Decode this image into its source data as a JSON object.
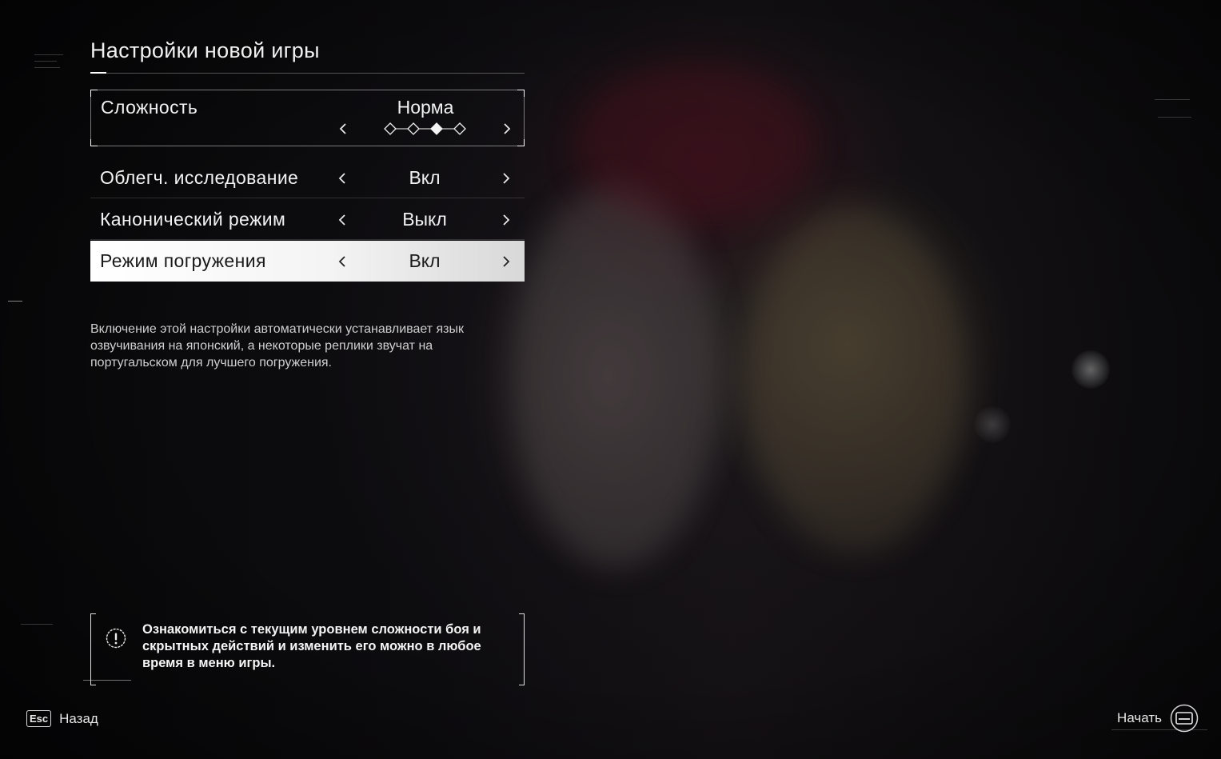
{
  "screen": {
    "title": "Настройки новой игры"
  },
  "settings": {
    "difficulty": {
      "label": "Сложность",
      "value": "Норма",
      "levels_total": 4,
      "level_selected": 3
    },
    "rows": [
      {
        "label": "Облегч. исследование",
        "value": "Вкл"
      },
      {
        "label": "Канонический режим",
        "value": "Выкл"
      },
      {
        "label": "Режим погружения",
        "value": "Вкл",
        "selected": true
      }
    ]
  },
  "description": {
    "line1": "Включение этой настройки автоматически устанавливает язык",
    "line2": "озвучивания на японский, а некоторые реплики звучат на",
    "line3": "португальском для лучшего погружения."
  },
  "notice": {
    "icon": "exclamation-icon",
    "line1": "Ознакомиться с текущим уровнем сложности боя и",
    "line2": "скрытных действий и изменить его можно в любое",
    "line3": "время в меню игры."
  },
  "footer": {
    "back_key": "Esc",
    "back_label": "Назад",
    "start_label": "Начать",
    "start_icon": "start-button-icon"
  },
  "colors": {
    "selected_row": "#ffffff",
    "text": "#f2f2f2",
    "background": "#0b0a0c"
  }
}
